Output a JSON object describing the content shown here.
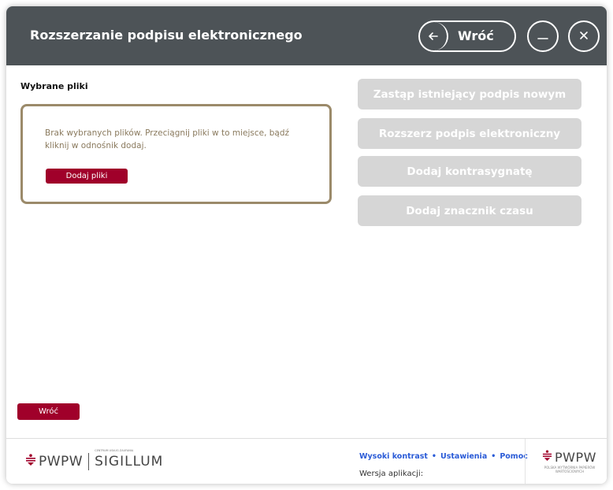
{
  "window": {
    "title": "Rozszerzanie podpisu elektronicznego",
    "back_label": "Wróć",
    "icons": [
      "arrow-left-icon",
      "minimize-icon",
      "close-icon"
    ]
  },
  "files": {
    "section_label": "Wybrane pliki",
    "empty_text": "Brak wybranych plików. Przeciągnij pliki w to miejsce, bądź kliknij w odnośnik dodaj.",
    "add_files_label": "Dodaj pliki"
  },
  "actions": [
    {
      "label": "Zastąp istniejący podpis nowym",
      "enabled": false
    },
    {
      "label": "Rozszerz podpis elektroniczny",
      "enabled": false
    },
    {
      "label": "Dodaj kontrasygnatę",
      "enabled": false
    },
    {
      "label": "Dodaj znacznik czasu",
      "enabled": false
    }
  ],
  "bottom": {
    "back_label": "Wróć"
  },
  "footer": {
    "logo_left_text": "PWPW",
    "sigillum_small": "CENTRUM USŁUG ZAUFANIA",
    "sigillum_text": "SIGILLUM",
    "links": [
      "Wysoki kontrast",
      "Ustawienia",
      "Pomoc"
    ],
    "version_label": "Wersja aplikacji:",
    "logo_right_text": "PWPW",
    "logo_right_sub": "POLSKA WYTWÓRNIA PAPIERÓW WARTOŚCIOWYCH"
  },
  "colors": {
    "titlebar": "#4d5357",
    "accent": "#a0002a",
    "disabled_button": "#d6d6d6",
    "dropzone_border": "#9b8a6a",
    "link": "#2a5bd7"
  }
}
